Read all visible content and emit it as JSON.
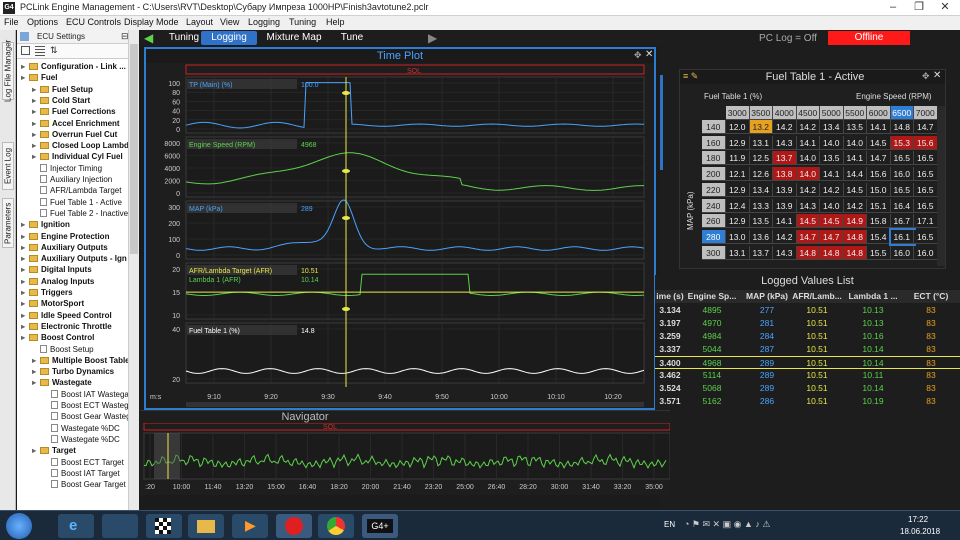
{
  "window": {
    "title": "PCLink Engine Management - C:\\Users\\RVT\\Desktop\\Субару Импреза 1000HP\\Finish3avtotune2.pclr",
    "app_icon": "G4"
  },
  "menu": [
    "File",
    "Options",
    "ECU Controls",
    "Display Mode",
    "Layout",
    "View",
    "Logging",
    "Tuning",
    "Help"
  ],
  "side_tabs": [
    "Log File Manager",
    "Event Log",
    "Parameters"
  ],
  "tree": {
    "title": "ECU Settings",
    "items": [
      {
        "label": "Configuration - Link ...",
        "lvl": 1,
        "type": "folder"
      },
      {
        "label": "Fuel",
        "lvl": 1,
        "type": "folder"
      },
      {
        "label": "Fuel Setup",
        "lvl": 2,
        "type": "folder"
      },
      {
        "label": "Cold Start",
        "lvl": 2,
        "type": "folder"
      },
      {
        "label": "Fuel Corrections",
        "lvl": 2,
        "type": "folder"
      },
      {
        "label": "Accel Enrichment",
        "lvl": 2,
        "type": "folder"
      },
      {
        "label": "Overrun Fuel Cut",
        "lvl": 2,
        "type": "folder"
      },
      {
        "label": "Closed Loop Lambda",
        "lvl": 2,
        "type": "folder"
      },
      {
        "label": "Individual Cyl Fuel",
        "lvl": 2,
        "type": "folder"
      },
      {
        "label": "Injector Timing",
        "lvl": 2,
        "type": "page"
      },
      {
        "label": "Auxiliary Injection",
        "lvl": 2,
        "type": "page"
      },
      {
        "label": "AFR/Lambda Target",
        "lvl": 2,
        "type": "page"
      },
      {
        "label": "Fuel Table 1 - Active",
        "lvl": 2,
        "type": "page"
      },
      {
        "label": "Fuel Table 2 - Inactive",
        "lvl": 2,
        "type": "page"
      },
      {
        "label": "Ignition",
        "lvl": 1,
        "type": "folder"
      },
      {
        "label": "Engine Protection",
        "lvl": 1,
        "type": "folder"
      },
      {
        "label": "Auxiliary Outputs",
        "lvl": 1,
        "type": "folder"
      },
      {
        "label": "Auxiliary Outputs - Ign",
        "lvl": 1,
        "type": "folder"
      },
      {
        "label": "Digital Inputs",
        "lvl": 1,
        "type": "folder"
      },
      {
        "label": "Analog Inputs",
        "lvl": 1,
        "type": "folder"
      },
      {
        "label": "Triggers",
        "lvl": 1,
        "type": "folder"
      },
      {
        "label": "MotorSport",
        "lvl": 1,
        "type": "folder"
      },
      {
        "label": "Idle Speed Control",
        "lvl": 1,
        "type": "folder"
      },
      {
        "label": "Electronic Throttle",
        "lvl": 1,
        "type": "folder"
      },
      {
        "label": "Boost Control",
        "lvl": 1,
        "type": "folder"
      },
      {
        "label": "Boost Setup",
        "lvl": 2,
        "type": "page"
      },
      {
        "label": "Multiple Boost Tables",
        "lvl": 2,
        "type": "folder"
      },
      {
        "label": "Turbo Dynamics",
        "lvl": 2,
        "type": "folder"
      },
      {
        "label": "Wastegate",
        "lvl": 2,
        "type": "folder"
      },
      {
        "label": "Boost IAT Wastegate",
        "lvl": 3,
        "type": "page"
      },
      {
        "label": "Boost ECT Wastegate",
        "lvl": 3,
        "type": "page"
      },
      {
        "label": "Boost Gear Wastegate",
        "lvl": 3,
        "type": "page"
      },
      {
        "label": "Wastegate %DC",
        "lvl": 3,
        "type": "page"
      },
      {
        "label": "Wastegate %DC",
        "lvl": 3,
        "type": "page"
      },
      {
        "label": "Target",
        "lvl": 2,
        "type": "folder"
      },
      {
        "label": "Boost ECT Target",
        "lvl": 3,
        "type": "page"
      },
      {
        "label": "Boost IAT Target",
        "lvl": 3,
        "type": "page"
      },
      {
        "label": "Boost Gear Target",
        "lvl": 3,
        "type": "page"
      }
    ]
  },
  "tabs": [
    {
      "label": "Tuning",
      "active": false
    },
    {
      "label": "Logging",
      "active": true
    },
    {
      "label": "Mixture Map",
      "active": false
    },
    {
      "label": "Tune",
      "active": false
    }
  ],
  "status": {
    "pc_log": "PC Log = Off",
    "connection": "Offline"
  },
  "timeplot": {
    "title": "Time Plot",
    "sol_label": "SOL",
    "time_unit": "m:s",
    "x_ticks": [
      "9:10",
      "9:20",
      "9:30",
      "9:40",
      "9:50",
      "10:00",
      "10:10",
      "10:20"
    ],
    "panels": [
      {
        "label": "TP (Main) (%)",
        "value": "100.0",
        "color": "#4aa3ff",
        "ticks": [
          "100",
          "80",
          "60",
          "40",
          "20",
          "0"
        ]
      },
      {
        "label": "Engine Speed (RPM)",
        "value": "4968",
        "color": "#5dd24b",
        "ticks": [
          "8000",
          "6000",
          "4000",
          "2000",
          "0"
        ]
      },
      {
        "label": "MAP (kPa)",
        "value": "289",
        "color": "#4aa3ff",
        "ticks": [
          "300",
          "200",
          "100",
          "0"
        ]
      },
      {
        "label": "AFR/Lambda Target (AFR)",
        "value": "10.51",
        "color": "#e8e84a",
        "label2": "Lambda 1 (AFR)",
        "value2": "10.14",
        "ticks": [
          "20",
          "15",
          "10"
        ]
      },
      {
        "label": "Fuel Table 1 (%)",
        "value": "14.8",
        "color": "#ffffff",
        "ticks": [
          "40",
          "20"
        ]
      }
    ]
  },
  "fuel_table": {
    "title": "Fuel Table 1 - Active",
    "corner_label": "Fuel Table 1 (%)",
    "x_axis": "Engine Speed (RPM)",
    "y_axis": "MAP (kPa)",
    "cols": [
      "3000",
      "3500",
      "4000",
      "4500",
      "5000",
      "5500",
      "6000",
      "6500",
      "7000"
    ],
    "rows": [
      {
        "map": "140",
        "v": [
          "12.0",
          "13.2",
          "14.2",
          "14.2",
          "13.4",
          "13.5",
          "14.1",
          "14.8",
          "14.7"
        ]
      },
      {
        "map": "160",
        "v": [
          "12.9",
          "13.1",
          "14.3",
          "14.1",
          "14.0",
          "14.0",
          "14.5",
          "15.3",
          "15.6"
        ]
      },
      {
        "map": "180",
        "v": [
          "11.9",
          "12.5",
          "13.7",
          "14.0",
          "13.5",
          "14.1",
          "14.7",
          "16.5",
          "16.5"
        ]
      },
      {
        "map": "200",
        "v": [
          "12.1",
          "12.6",
          "13.8",
          "14.0",
          "14.1",
          "14.4",
          "15.6",
          "16.0",
          "16.5"
        ]
      },
      {
        "map": "220",
        "v": [
          "12.9",
          "13.4",
          "13.9",
          "14.2",
          "14.2",
          "14.5",
          "15.0",
          "16.5",
          "16.5"
        ]
      },
      {
        "map": "240",
        "v": [
          "12.4",
          "13.3",
          "13.9",
          "14.3",
          "14.0",
          "14.2",
          "15.1",
          "16.4",
          "16.5"
        ]
      },
      {
        "map": "260",
        "v": [
          "12.9",
          "13.5",
          "14.1",
          "14.5",
          "14.5",
          "14.9",
          "15.8",
          "16.7",
          "17.1"
        ]
      },
      {
        "map": "280",
        "v": [
          "13.0",
          "13.6",
          "14.2",
          "14.7",
          "14.7",
          "14.8",
          "15.4",
          "16.1",
          "16.5"
        ]
      },
      {
        "map": "300",
        "v": [
          "13.1",
          "13.7",
          "14.3",
          "14.8",
          "14.8",
          "14.8",
          "15.5",
          "16.0",
          "16.0"
        ]
      }
    ],
    "highlight": {
      "col": "6500",
      "row": "280"
    }
  },
  "logged_values": {
    "title": "Logged Values List",
    "headers": [
      "ime (s)",
      "Engine Sp...",
      "MAP (kPa)",
      "AFR/Lamb...",
      "Lambda 1 ...",
      "ECT (°C)"
    ],
    "rows": [
      [
        "3.134",
        "4895",
        "277",
        "10.51",
        "10.13",
        "83"
      ],
      [
        "3.197",
        "4970",
        "281",
        "10.51",
        "10.13",
        "83"
      ],
      [
        "3.259",
        "4984",
        "284",
        "10.51",
        "10.16",
        "83"
      ],
      [
        "3.337",
        "5044",
        "287",
        "10.51",
        "10.14",
        "83"
      ],
      [
        "3.400",
        "4968",
        "289",
        "10.51",
        "10.14",
        "83"
      ],
      [
        "3.462",
        "5114",
        "289",
        "10.51",
        "10.11",
        "83"
      ],
      [
        "3.524",
        "5068",
        "289",
        "10.51",
        "10.14",
        "83"
      ],
      [
        "3.571",
        "5162",
        "286",
        "10.51",
        "10.19",
        "83"
      ]
    ]
  },
  "navigator": {
    "title": "Navigator",
    "sol_label": "SOL",
    "ticks": [
      ":20",
      "10:00",
      "11:40",
      "13:20",
      "15:00",
      "16:40",
      "18:20",
      "20:00",
      "21:40",
      "23:20",
      "25:00",
      "26:40",
      "28:20",
      "30:00",
      "31:40",
      "33:20",
      "35:00"
    ]
  },
  "taskbar": {
    "lang": "EN",
    "time": "17:22",
    "date": "18.06.2018",
    "g4_label": "G4+"
  }
}
